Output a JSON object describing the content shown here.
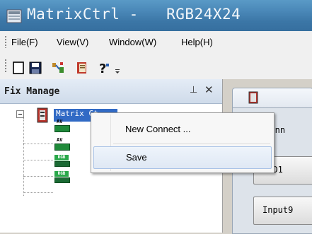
{
  "window": {
    "title": "MatrixCtrl -   RGB24X24",
    "app_icon": "matrix-app-icon"
  },
  "menu": {
    "items": [
      {
        "label": "File(F)"
      },
      {
        "label": "View(V)"
      },
      {
        "label": "Window(W)"
      },
      {
        "label": "Help(H)"
      }
    ]
  },
  "toolbar": {
    "buttons": [
      {
        "icon": "new-document-icon"
      },
      {
        "icon": "save-icon"
      },
      {
        "icon": "connect-icon"
      },
      {
        "icon": "book-icon"
      },
      {
        "icon": "help-icon"
      }
    ],
    "overflow_icon": "chevron-down-icon"
  },
  "fix_manage": {
    "title": "Fix Manage",
    "pin_glyph": "⊥",
    "close_glyph": "✕",
    "tree": {
      "root_label": "Matrix Ct",
      "children": [
        {
          "type": "AV"
        },
        {
          "type": "AV"
        },
        {
          "type": "RGB"
        },
        {
          "type": "RGB"
        }
      ]
    }
  },
  "context_menu": {
    "items": [
      {
        "label": "New Connect ..."
      },
      {
        "label": "Save"
      }
    ]
  },
  "main": {
    "channel_label": "Chann",
    "buttons": [
      {
        "label": "DVD1"
      },
      {
        "label": "Input9"
      }
    ]
  },
  "colors": {
    "titlebar": "#4a88b8",
    "selection": "#316ac5",
    "context_hover": "#dfe8f4"
  }
}
